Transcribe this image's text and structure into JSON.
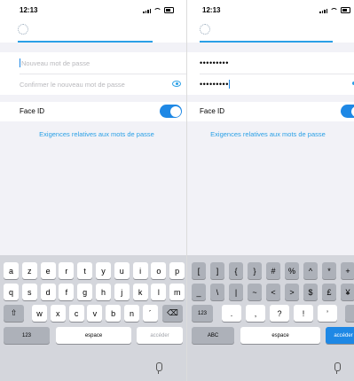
{
  "left": {
    "time": "12:13",
    "new_password_placeholder": "Nouveau mot de passe",
    "confirm_password_placeholder": "Confirmer le nouveau mot de passe",
    "faceid_label": "Face ID",
    "requirements_link": "Exigences relatives aux mots de passe",
    "kb_row1": [
      "a",
      "z",
      "e",
      "r",
      "t",
      "y",
      "u",
      "i",
      "o",
      "p"
    ],
    "kb_row2": [
      "q",
      "s",
      "d",
      "f",
      "g",
      "h",
      "j",
      "k",
      "l",
      "m"
    ],
    "kb_row3": [
      "w",
      "x",
      "c",
      "v",
      "b",
      "n",
      "´"
    ],
    "shift_key": "⇧",
    "delete_key": "⌫",
    "numbers_key": "123",
    "space_key": "espace",
    "return_key": "accéder"
  },
  "right": {
    "time": "12:13",
    "password_value": "•••••••••",
    "confirm_value": "•••••••••",
    "faceid_label": "Face ID",
    "requirements_link": "Exigences relatives aux mots de passe",
    "kb_row1": [
      "[",
      "]",
      "{",
      "}",
      "#",
      "%",
      "^",
      "*",
      "+"
    ],
    "kb_row2": [
      "_",
      "\\",
      "|",
      "~",
      "<",
      ">",
      "$",
      "£",
      "¥"
    ],
    "kb_row3": [
      ".",
      ",",
      "?",
      "!",
      "’"
    ],
    "numbers_key": "123",
    "abc_key": "ABC",
    "space_key": "espace",
    "return_key": "accéder"
  },
  "colors": {
    "accent": "#2aa0e6",
    "toggle_on": "#1e88e5",
    "keyboard_bg": "#d4d6dc"
  }
}
